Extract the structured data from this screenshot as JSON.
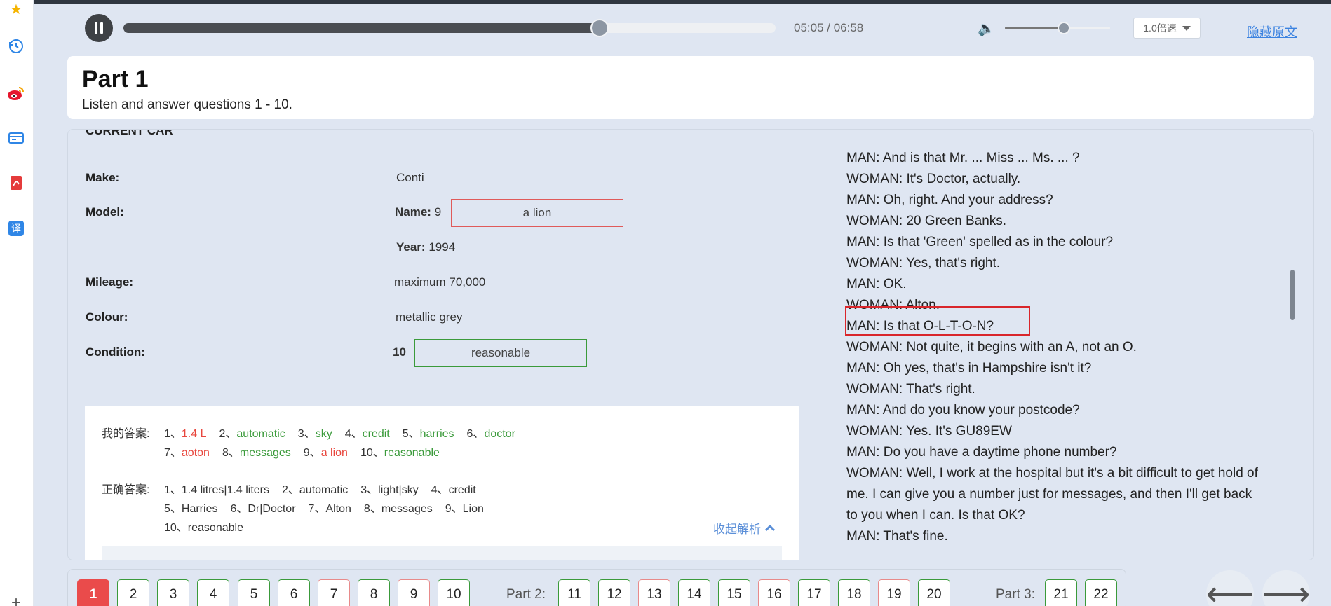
{
  "rail": {
    "icons": [
      "star-icon",
      "history-icon",
      "weibo-icon",
      "card-icon",
      "pdf-icon",
      "translate-icon",
      "plus-icon"
    ],
    "translate_glyph": "译",
    "plus_glyph": "+"
  },
  "player": {
    "time": "05:05 / 06:58",
    "progress_fraction": 0.73,
    "volume_fraction": 0.56,
    "speed": "1.0倍速",
    "hide_link": "隐藏原文"
  },
  "header": {
    "title": "Part 1",
    "subtitle": "Listen and answer questions 1 - 10."
  },
  "form": {
    "cut_label": "CURRENT CAR",
    "make_label": "Make:",
    "make_value": "Conti",
    "model_label": "Model:",
    "name_label": "Name:",
    "name_qnum": "9",
    "name_answer": "a lion",
    "year_label": "Year:",
    "year_value": "1994",
    "mileage_label": "Mileage:",
    "mileage_value": "maximum 70,000",
    "colour_label": "Colour:",
    "colour_value": "metallic grey",
    "condition_label": "Condition:",
    "condition_qnum": "10",
    "condition_answer": "reasonable"
  },
  "analysis": {
    "my_label": "我的答案:",
    "my_answers_row1": [
      {
        "n": "1、",
        "v": "1.4 L",
        "ok": false
      },
      {
        "n": "2、",
        "v": "automatic",
        "ok": true
      },
      {
        "n": "3、",
        "v": "sky",
        "ok": true
      },
      {
        "n": "4、",
        "v": "credit",
        "ok": true
      },
      {
        "n": "5、",
        "v": "harries",
        "ok": true
      },
      {
        "n": "6、",
        "v": "doctor",
        "ok": true
      }
    ],
    "my_answers_row2": [
      {
        "n": "7、",
        "v": "aoton",
        "ok": false
      },
      {
        "n": "8、",
        "v": "messages",
        "ok": true
      },
      {
        "n": "9、",
        "v": "a lion",
        "ok": false
      },
      {
        "n": "10、",
        "v": "reasonable",
        "ok": true
      }
    ],
    "correct_label": "正确答案:",
    "correct_row1": [
      "1、1.4 litres|1.4 liters",
      "2、automatic",
      "3、light|sky",
      "4、credit"
    ],
    "correct_row2": [
      "5、Harries",
      "6、Dr|Doctor",
      "7、Alton",
      "8、messages",
      "9、Lion"
    ],
    "correct_row3": [
      "10、reasonable"
    ],
    "collapse_label": "收起解析"
  },
  "transcript": [
    "MAN: And is that Mr. ... Miss ... Ms. ... ?",
    "WOMAN: It's Doctor, actually.",
    "MAN: Oh, right. And your address?",
    "WOMAN: 20 Green Banks.",
    "MAN: Is that 'Green' spelled as in the colour?",
    "WOMAN: Yes, that's right.",
    "MAN: OK.",
    "WOMAN: Alton.",
    "MAN: Is that O-L-T-O-N?",
    "WOMAN: Not quite, it begins with an A, not an O.",
    "MAN: Oh yes, that's in Hampshire isn't it?",
    "WOMAN: That's right.",
    "MAN: And do you know your postcode?",
    "WOMAN: Yes. It's GU89EW",
    "MAN: Do you have a daytime phone number?",
    "WOMAN: Well, I work at the hospital but it's a bit difficult to get hold of",
    "me. I can give you a number just for messages, and then I'll get back",
    "to you when I can. Is that OK?",
    "MAN: That's fine."
  ],
  "nav": {
    "part2_label": "Part 2:",
    "part3_label": "Part 3:",
    "questions": [
      {
        "n": "1",
        "state": "current"
      },
      {
        "n": "2",
        "state": "correct"
      },
      {
        "n": "3",
        "state": "correct"
      },
      {
        "n": "4",
        "state": "correct"
      },
      {
        "n": "5",
        "state": "correct"
      },
      {
        "n": "6",
        "state": "correct"
      },
      {
        "n": "7",
        "state": "wrong"
      },
      {
        "n": "8",
        "state": "correct"
      },
      {
        "n": "9",
        "state": "wrong"
      },
      {
        "n": "10",
        "state": "correct"
      },
      {
        "n": "11",
        "state": "correct"
      },
      {
        "n": "12",
        "state": "correct"
      },
      {
        "n": "13",
        "state": "wrong"
      },
      {
        "n": "14",
        "state": "correct"
      },
      {
        "n": "15",
        "state": "correct"
      },
      {
        "n": "16",
        "state": "wrong"
      },
      {
        "n": "17",
        "state": "correct"
      },
      {
        "n": "18",
        "state": "correct"
      },
      {
        "n": "19",
        "state": "wrong"
      },
      {
        "n": "20",
        "state": "correct"
      },
      {
        "n": "21",
        "state": "correct"
      },
      {
        "n": "22",
        "state": "correct"
      }
    ],
    "prev_glyph": "⟵",
    "next_glyph": "⟶"
  },
  "colors": {
    "accent": "#3b82e0",
    "correct": "#3a9a3a",
    "wrong": "#e8473e",
    "current": "#ea4b4b"
  }
}
